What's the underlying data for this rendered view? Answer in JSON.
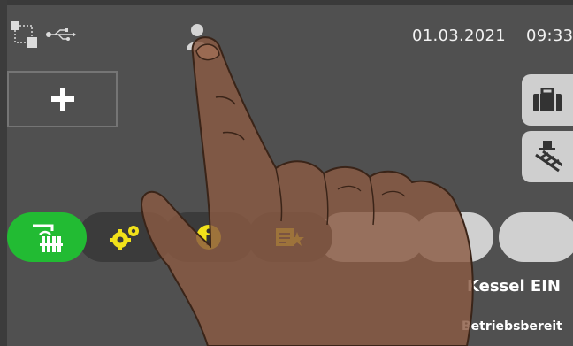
{
  "status_bar": {
    "date": "01.03.2021",
    "time": "09:33",
    "icons": [
      "network-icon",
      "usb-icon",
      "user-icon"
    ]
  },
  "main": {
    "add_button_icon": "plus-icon"
  },
  "side_buttons": [
    {
      "icon": "briefcase-icon"
    },
    {
      "icon": "chimney-sweep-icon"
    }
  ],
  "tabbar": {
    "tabs": [
      {
        "icon": "heating-radiator-icon",
        "active": true
      },
      {
        "icon": "gears-icon",
        "active": false
      },
      {
        "icon": "info-icon",
        "active": false
      },
      {
        "icon": "notes-star-icon",
        "active": false
      }
    ]
  },
  "status": {
    "kessel": "Kessel EIN",
    "betrieb": "Betriebsbereit"
  },
  "colors": {
    "background": "#505050",
    "active_tab": "#22bb33",
    "icon_yellow": "#f2e21a",
    "side_button": "#cfcfcf"
  }
}
